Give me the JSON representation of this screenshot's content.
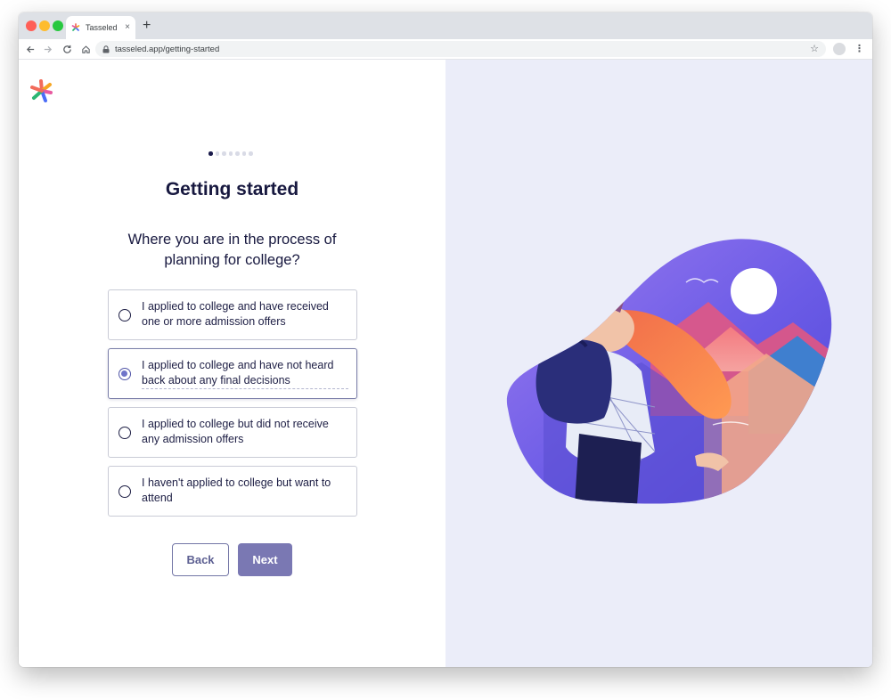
{
  "browser": {
    "tab_title": "Tasseled",
    "tab_close": "×",
    "new_tab": "+",
    "url": "tasseled.app/getting-started",
    "icons": [
      "back-arrow-icon",
      "forward-arrow-icon",
      "reload-icon",
      "home-icon",
      "lock-icon",
      "star-icon",
      "menu-icon"
    ]
  },
  "onboarding": {
    "step_current": 1,
    "step_total": 7,
    "title": "Getting started",
    "question": "Where you are in the process of planning for college?",
    "options": [
      {
        "label": "I applied to college and have received one or more admission offers",
        "selected": false
      },
      {
        "label": "I applied to college and have not heard back about any final decisions",
        "selected": true
      },
      {
        "label": "I applied to college but did not receive any admission offers",
        "selected": false
      },
      {
        "label": "I haven't applied to college but want to attend",
        "selected": false
      }
    ],
    "back_label": "Back",
    "next_label": "Next"
  },
  "colors": {
    "heading": "#17183f",
    "accent": "#7a78b3",
    "right_panel_bg": "#ebedf9"
  }
}
